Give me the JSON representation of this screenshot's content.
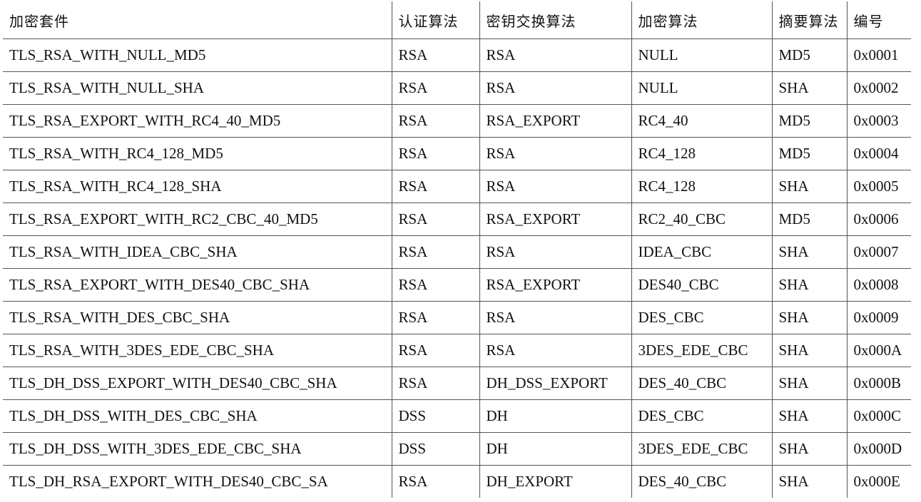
{
  "table": {
    "headers": [
      "加密套件",
      "认证算法",
      "密钥交换算法",
      "加密算法",
      "摘要算法",
      "编号"
    ],
    "rows": [
      [
        "TLS_RSA_WITH_NULL_MD5",
        "RSA",
        "RSA",
        "NULL",
        "MD5",
        "0x0001"
      ],
      [
        "TLS_RSA_WITH_NULL_SHA",
        "RSA",
        "RSA",
        "NULL",
        "SHA",
        "0x0002"
      ],
      [
        "TLS_RSA_EXPORT_WITH_RC4_40_MD5",
        "RSA",
        "RSA_EXPORT",
        "RC4_40",
        "MD5",
        "0x0003"
      ],
      [
        "TLS_RSA_WITH_RC4_128_MD5",
        "RSA",
        "RSA",
        "RC4_128",
        "MD5",
        "0x0004"
      ],
      [
        "TLS_RSA_WITH_RC4_128_SHA",
        "RSA",
        "RSA",
        "RC4_128",
        "SHA",
        "0x0005"
      ],
      [
        "TLS_RSA_EXPORT_WITH_RC2_CBC_40_MD5",
        "RSA",
        "RSA_EXPORT",
        "RC2_40_CBC",
        "MD5",
        "0x0006"
      ],
      [
        "TLS_RSA_WITH_IDEA_CBC_SHA",
        "RSA",
        "RSA",
        "IDEA_CBC",
        "SHA",
        "0x0007"
      ],
      [
        "TLS_RSA_EXPORT_WITH_DES40_CBC_SHA",
        "RSA",
        "RSA_EXPORT",
        "DES40_CBC",
        "SHA",
        "0x0008"
      ],
      [
        "TLS_RSA_WITH_DES_CBC_SHA",
        "RSA",
        "RSA",
        "DES_CBC",
        "SHA",
        "0x0009"
      ],
      [
        "TLS_RSA_WITH_3DES_EDE_CBC_SHA",
        "RSA",
        "RSA",
        "3DES_EDE_CBC",
        "SHA",
        "0x000A"
      ],
      [
        "TLS_DH_DSS_EXPORT_WITH_DES40_CBC_SHA",
        "RSA",
        "DH_DSS_EXPORT",
        "DES_40_CBC",
        "SHA",
        "0x000B"
      ],
      [
        "TLS_DH_DSS_WITH_DES_CBC_SHA",
        "DSS",
        "DH",
        "DES_CBC",
        "SHA",
        "0x000C"
      ],
      [
        "TLS_DH_DSS_WITH_3DES_EDE_CBC_SHA",
        "DSS",
        "DH",
        "3DES_EDE_CBC",
        "SHA",
        "0x000D"
      ],
      [
        "TLS_DH_RSA_EXPORT_WITH_DES40_CBC_SA",
        "RSA",
        "DH_EXPORT",
        "DES_40_CBC",
        "SHA",
        "0x000E"
      ]
    ]
  }
}
